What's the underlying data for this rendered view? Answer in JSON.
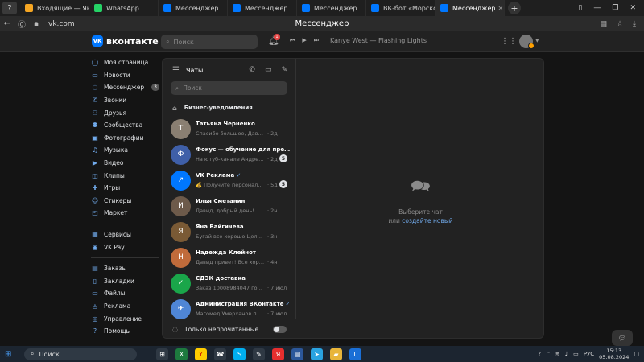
{
  "browser": {
    "tabs": [
      {
        "label": "Входящие — Яндекс",
        "color": "#f5a623",
        "active": false
      },
      {
        "label": "WhatsApp",
        "color": "#25d366",
        "active": false
      },
      {
        "label": "Мессенджер",
        "color": "#0077ff",
        "active": false
      },
      {
        "label": "Мессенджер",
        "color": "#0077ff",
        "active": false
      },
      {
        "label": "Мессенджер",
        "color": "#0077ff",
        "active": false
      },
      {
        "label": "ВК-бот «Морской з",
        "color": "#0077ff",
        "active": false
      },
      {
        "label": "Мессенджер",
        "color": "#0077ff",
        "active": true
      }
    ],
    "url": "vk.com",
    "page_title": "Мессенджер"
  },
  "header": {
    "logo_text": "VK",
    "brand": "вконтакте",
    "search_placeholder": "Поиск",
    "notif_count": "1",
    "track": "Kanye West — Flashing Lights"
  },
  "sidebar": {
    "group1": [
      {
        "label": "Моя страница",
        "icon": "user-icon",
        "glyph": "◯"
      },
      {
        "label": "Новости",
        "icon": "news-icon",
        "glyph": "▭"
      },
      {
        "label": "Мессенджер",
        "icon": "message-icon",
        "glyph": "◌",
        "count": "3"
      },
      {
        "label": "Звонки",
        "icon": "phone-icon",
        "glyph": "✆"
      },
      {
        "label": "Друзья",
        "icon": "friends-icon",
        "glyph": "⚇"
      },
      {
        "label": "Сообщества",
        "icon": "groups-icon",
        "glyph": "⚉"
      },
      {
        "label": "Фотографии",
        "icon": "photo-icon",
        "glyph": "▣"
      },
      {
        "label": "Музыка",
        "icon": "music-icon",
        "glyph": "♫"
      },
      {
        "label": "Видео",
        "icon": "video-icon",
        "glyph": "▶"
      },
      {
        "label": "Клипы",
        "icon": "clips-icon",
        "glyph": "◫"
      },
      {
        "label": "Игры",
        "icon": "games-icon",
        "glyph": "✚"
      },
      {
        "label": "Стикеры",
        "icon": "sticker-icon",
        "glyph": "☺"
      },
      {
        "label": "Маркет",
        "icon": "market-icon",
        "glyph": "◰"
      }
    ],
    "group2": [
      {
        "label": "Сервисы",
        "icon": "services-icon",
        "glyph": "▦"
      },
      {
        "label": "VK Pay",
        "icon": "vkpay-icon",
        "glyph": "◉"
      }
    ],
    "group3": [
      {
        "label": "Заказы",
        "icon": "orders-icon",
        "glyph": "▤"
      },
      {
        "label": "Закладки",
        "icon": "bookmark-icon",
        "glyph": "▯"
      },
      {
        "label": "Файлы",
        "icon": "files-icon",
        "glyph": "▭"
      },
      {
        "label": "Реклама",
        "icon": "ads-icon",
        "glyph": "◬"
      },
      {
        "label": "Управление",
        "icon": "manage-icon",
        "glyph": "◎"
      },
      {
        "label": "Помощь",
        "icon": "help-icon",
        "glyph": "?"
      }
    ]
  },
  "chats": {
    "title": "Чаты",
    "search_placeholder": "Поиск",
    "business": "Бизнес-уведомления",
    "items": [
      {
        "name": "Татьяна Черненко",
        "preview": "Спасибо большое, Давид!",
        "time": "· 2д",
        "color": "#8a7f72",
        "initial": "Т",
        "verified": false,
        "unread": ""
      },
      {
        "name": "Фокус — обучение для предприним…",
        "preview": "На ютуб-канале Андрея Ка…",
        "time": "· 2д",
        "color": "#3f5fa8",
        "initial": "Ф",
        "verified": false,
        "unread": "5"
      },
      {
        "name": "VK Реклама",
        "preview": "💰 Получите персональны…",
        "time": "· 5д",
        "color": "#0077ff",
        "initial": "↗",
        "verified": true,
        "unread": "5"
      },
      {
        "name": "Илья Сметанин",
        "preview": "Давид, добрый день! Спасибо …",
        "time": "· 2н",
        "color": "#6d5a4a",
        "initial": "И",
        "verified": false,
        "unread": ""
      },
      {
        "name": "Яна Вайгичева",
        "preview": "Бугай все хорошо Целую ❤️",
        "time": "· 3н",
        "color": "#7a5a35",
        "initial": "Я",
        "verified": false,
        "unread": ""
      },
      {
        "name": "Надежда Клейнот",
        "preview": "Давид привет! Все хорошо спа…",
        "time": "· 4н",
        "color": "#c06b3b",
        "initial": "Н",
        "verified": false,
        "unread": ""
      },
      {
        "name": "СДЭК доставка",
        "preview": "Заказ 10008984047 готов к…",
        "time": "· 7 июл",
        "color": "#1aa64a",
        "initial": "✓",
        "verified": false,
        "unread": ""
      },
      {
        "name": "Администрация ВКонтакте",
        "preview": "Магомед Умерханов поменя…",
        "time": "· 7 июл",
        "color": "#4f86d6",
        "initial": "✈",
        "verified": true,
        "unread": ""
      }
    ],
    "unread_only": "Только непрочитанные"
  },
  "empty_state": {
    "line1": "Выберите чат",
    "line2_prefix": "или ",
    "line2_link": "создайте новый"
  },
  "taskbar": {
    "search_label": "Поиск",
    "lang": "РУС",
    "time": "15:13",
    "date": "05.08.2024",
    "apps": [
      {
        "glyph": "⊞",
        "color": "#2f3944",
        "icon": "taskview-icon"
      },
      {
        "glyph": "X",
        "color": "#1d7a3e",
        "icon": "excel-icon"
      },
      {
        "glyph": "Y",
        "color": "#ffcc00",
        "icon": "yandex-browser-icon"
      },
      {
        "glyph": "☎",
        "color": "#2f3944",
        "icon": "phone-link-icon"
      },
      {
        "glyph": "S",
        "color": "#00aff0",
        "icon": "skype-icon"
      },
      {
        "glyph": "✎",
        "color": "#2f3944",
        "icon": "pen-icon"
      },
      {
        "glyph": "Я",
        "color": "#e62e2e",
        "icon": "yandex-icon"
      },
      {
        "glyph": "▤",
        "color": "#2b579a",
        "icon": "word-icon"
      },
      {
        "glyph": "➤",
        "color": "#2aa3e0",
        "icon": "telegram-icon"
      },
      {
        "glyph": "▰",
        "color": "#e8b53a",
        "icon": "folder-icon"
      },
      {
        "glyph": "L",
        "color": "#1a6fd6",
        "icon": "lingualeo-icon"
      }
    ]
  }
}
